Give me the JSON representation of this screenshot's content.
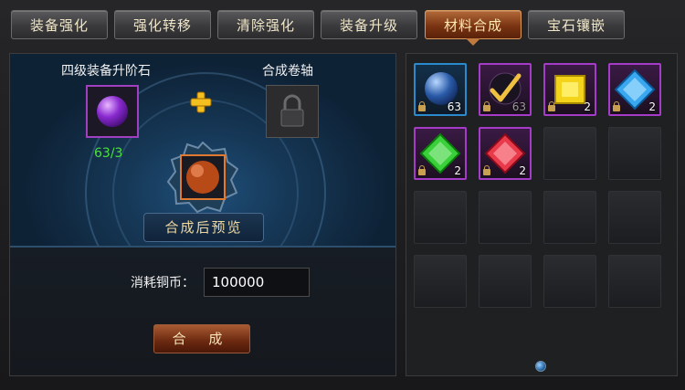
{
  "tabs": [
    {
      "label": "装备强化",
      "active": false
    },
    {
      "label": "强化转移",
      "active": false
    },
    {
      "label": "清除强化",
      "active": false
    },
    {
      "label": "装备升级",
      "active": false
    },
    {
      "label": "材料合成",
      "active": true
    },
    {
      "label": "宝石镶嵌",
      "active": false
    }
  ],
  "synthesis": {
    "material_label": "四级装备升阶石",
    "scroll_label": "合成卷轴",
    "material_count": "63/3",
    "preview_label": "合成后预览",
    "cost_label": "消耗铜币：",
    "cost_value": "100000",
    "craft_button": "合 成"
  },
  "inventory": {
    "items": [
      {
        "icon": "blue-sphere-icon",
        "count": "63",
        "locked": true,
        "rarity_color": "#2a8acb"
      },
      {
        "icon": "gold-checkmark-scroll-icon",
        "count": "63",
        "locked": true,
        "rarity_color": "#a43cc8"
      },
      {
        "icon": "yellow-gem-icon",
        "count": "2",
        "locked": true,
        "rarity_color": "#a43cc8"
      },
      {
        "icon": "blue-gem-icon",
        "count": "2",
        "locked": true,
        "rarity_color": "#a43cc8"
      },
      {
        "icon": "green-gem-icon",
        "count": "2",
        "locked": true,
        "rarity_color": "#a43cc8"
      },
      {
        "icon": "red-gem-icon",
        "count": "2",
        "locked": true,
        "rarity_color": "#a43cc8"
      }
    ],
    "empty_slots": 10,
    "page": 1
  },
  "colors": {
    "active_tab": "#7a3412",
    "count_green": "#4ae23a",
    "epic_border": "#a43cc8",
    "rare_border": "#2a8acb"
  }
}
